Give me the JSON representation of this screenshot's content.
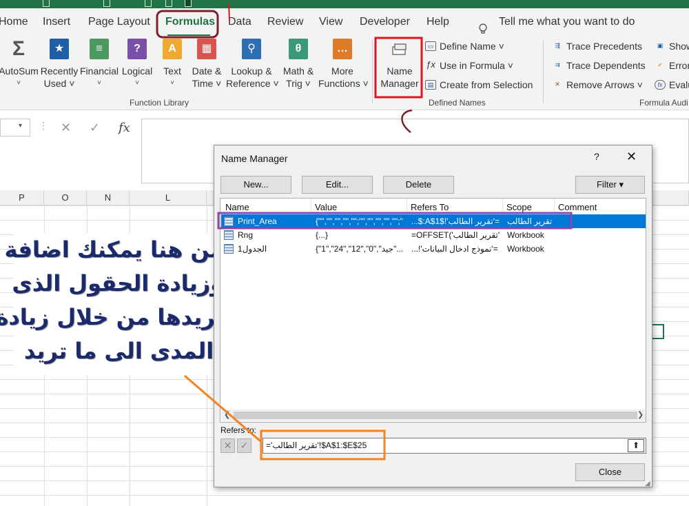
{
  "ribbon_tabs": [
    {
      "label": "Home"
    },
    {
      "label": "Insert"
    },
    {
      "label": "Page Layout"
    },
    {
      "label": "Formulas"
    },
    {
      "label": "Data"
    },
    {
      "label": "Review"
    },
    {
      "label": "View"
    },
    {
      "label": "Developer"
    },
    {
      "label": "Help"
    }
  ],
  "active_tab": "Formulas",
  "tell_me": "Tell me what you want to do",
  "function_library": {
    "group_label": "Function Library",
    "buttons": [
      {
        "line1": "AutoSum",
        "line2": "˅"
      },
      {
        "line1": "Recently",
        "line2": "Used ˅"
      },
      {
        "line1": "Financial",
        "line2": "˅"
      },
      {
        "line1": "Logical",
        "line2": "˅"
      },
      {
        "line1": "Text",
        "line2": "˅"
      },
      {
        "line1": "Date &",
        "line2": "Time ˅"
      },
      {
        "line1": "Lookup &",
        "line2": "Reference ˅"
      },
      {
        "line1": "Math &",
        "line2": "Trig ˅"
      },
      {
        "line1": "More",
        "line2": "Functions ˅"
      }
    ]
  },
  "defined_names": {
    "group_label": "Defined Names",
    "name_manager": {
      "line1": "Name",
      "line2": "Manager"
    },
    "define_name": "Define Name ˅",
    "use_in_formula": "Use in Formula ˅",
    "create_from_selection": "Create from Selection"
  },
  "formula_auditing": {
    "group_label": "Formula Audi",
    "trace_precedents": "Trace Precedents",
    "trace_dependents": "Trace Dependents",
    "remove_arrows": "Remove Arrows ˅",
    "show": "Show",
    "error": "Error",
    "evaluate": "Evalu"
  },
  "formula_bar": {
    "cancel": "✕",
    "enter": "✓",
    "fx": "fx"
  },
  "columns": [
    "P",
    "O",
    "N",
    "L"
  ],
  "annotation": {
    "lines": [
      "من هنا يمكنك اضافة",
      "وزيادة الحقول الذى",
      "تريدها من خلال زيادة",
      "المدى الى ما تريد"
    ]
  },
  "dialog": {
    "title": "Name Manager",
    "help": "?",
    "close_x": "✕",
    "buttons": {
      "new": "New...",
      "edit": "Edit...",
      "delete": "Delete",
      "filter": "Filter ▾",
      "close": "Close"
    },
    "columns": [
      "Name",
      "Value",
      "Refers To",
      "Scope",
      "Comment"
    ],
    "rows": [
      {
        "name": "Print_Area",
        "value": "{\"\",\"\",\"\",\"\",\"\";\"\",\"\",\"\",\"\",\"\";\"...",
        "refers_to": "='تقرير الطالب'!$A$1:$...",
        "scope": "تقرير الطالب",
        "comment": "",
        "selected": true
      },
      {
        "name": "Rng",
        "value": "{...}",
        "refers_to": "=OFFSET('تقرير الطالب'...",
        "scope": "Workbook",
        "comment": "",
        "selected": false
      },
      {
        "name": "الجدول1",
        "value": "{\"1\",\"24\",\"12\",\"0\",\"جيد\"...",
        "refers_to": "='نموذج ادخال البيانات'!...",
        "scope": "Workbook",
        "comment": "",
        "selected": false
      }
    ],
    "refers_to_label": "Refers to:",
    "refers_to_value": "='تقرير الطالب'!$A$1:$E$25"
  },
  "colors": {
    "excel_green": "#217346",
    "selection_blue": "#0078d7",
    "callout_red": "#e0151b",
    "callout_orange": "#f58220",
    "callout_purple": "#8e44ad",
    "annotation_navy": "#1a2a6c"
  }
}
